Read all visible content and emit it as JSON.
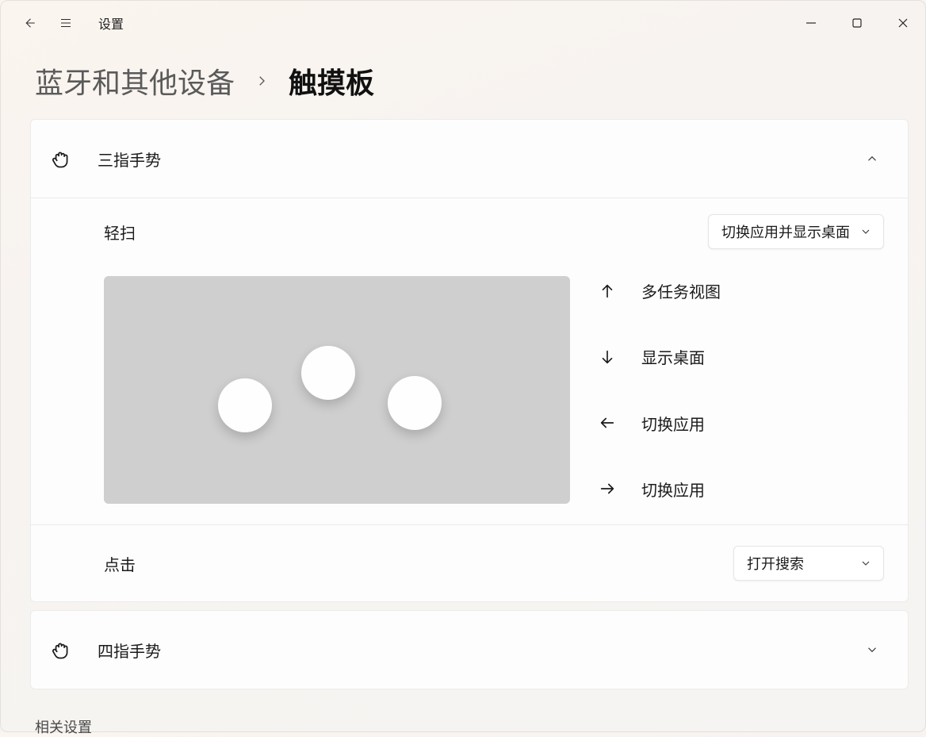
{
  "app": {
    "title": "设置"
  },
  "breadcrumb": {
    "parent": "蓝牙和其他设备",
    "current": "触摸板"
  },
  "threeFinger": {
    "title": "三指手势",
    "swipe": {
      "label": "轻扫",
      "selected": "切换应用并显示桌面",
      "directions": {
        "up": "多任务视图",
        "down": "显示桌面",
        "left": "切换应用",
        "right": "切换应用"
      }
    },
    "tap": {
      "label": "点击",
      "selected": "打开搜索"
    }
  },
  "fourFinger": {
    "title": "四指手势"
  },
  "related": {
    "heading": "相关设置"
  }
}
